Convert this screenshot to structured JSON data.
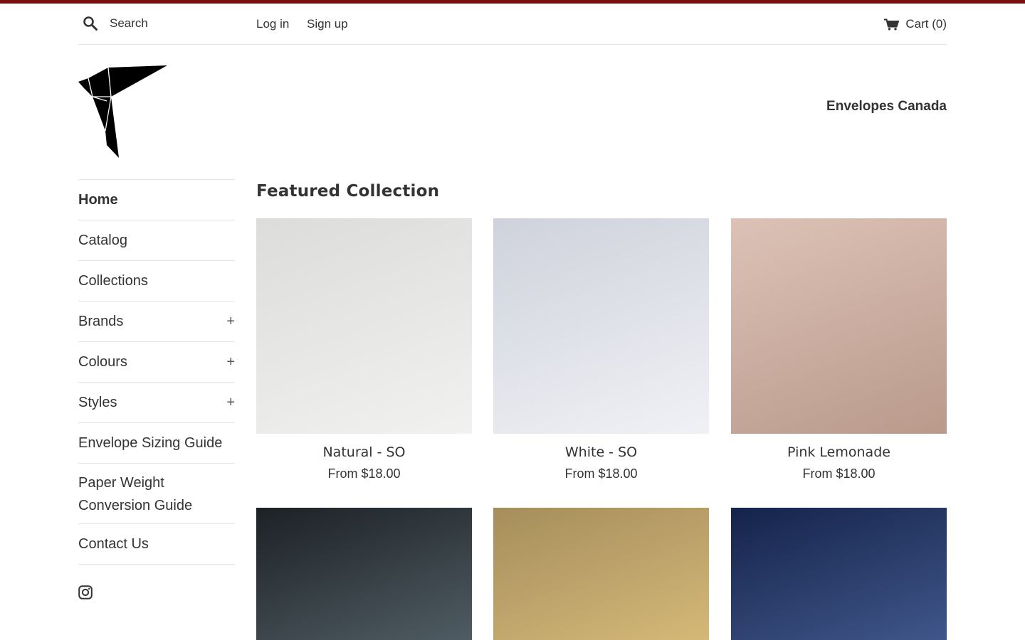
{
  "header": {
    "search_placeholder": "Search",
    "login_label": "Log in",
    "signup_label": "Sign up",
    "cart_label": "Cart (0)"
  },
  "brand": {
    "store_name": "Envelopes Canada",
    "accent_color": "#7a1010"
  },
  "sidebar": {
    "items": [
      {
        "label": "Home",
        "active": true
      },
      {
        "label": "Catalog"
      },
      {
        "label": "Collections"
      },
      {
        "label": "Brands",
        "expandable": true
      },
      {
        "label": "Colours",
        "expandable": true
      },
      {
        "label": "Styles",
        "expandable": true
      },
      {
        "label": "Envelope Sizing Guide"
      },
      {
        "label": "Paper Weight Conversion Guide"
      },
      {
        "label": "Contact Us"
      }
    ],
    "expand_symbol": "+",
    "social_icon": "instagram-icon"
  },
  "main": {
    "title": "Featured Collection",
    "products": [
      {
        "name": "Natural - SO",
        "price": "From $18.00",
        "color_from": "#dcdcda",
        "color_to": "#f1f1ef"
      },
      {
        "name": "White - SO",
        "price": "From $18.00",
        "color_from": "#cfd2dc",
        "color_to": "#f0f1f5"
      },
      {
        "name": "Pink Lemonade",
        "price": "From $18.00",
        "color_from": "#dcc2b6",
        "color_to": "#b99a8b"
      },
      {
        "name": "",
        "price": "",
        "color_from": "#1c2125",
        "color_to": "#4f5c63"
      },
      {
        "name": "",
        "price": "",
        "color_from": "#a58e5c",
        "color_to": "#d5b878"
      },
      {
        "name": "",
        "price": "",
        "color_from": "#14234a",
        "color_to": "#40568a"
      }
    ]
  }
}
